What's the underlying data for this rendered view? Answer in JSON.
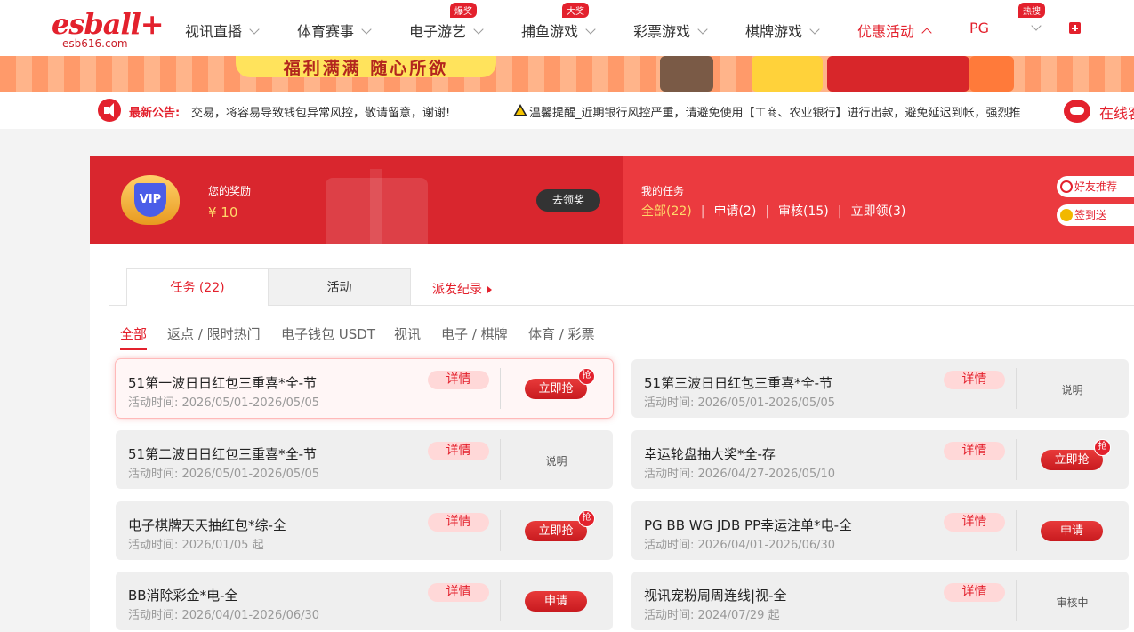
{
  "logo": {
    "word": "esball+",
    "sub": "esb616.com"
  },
  "nav": {
    "items": [
      {
        "label": "视讯直播",
        "badge": ""
      },
      {
        "label": "体育赛事",
        "badge": ""
      },
      {
        "label": "电子游艺",
        "badge": "爆奖"
      },
      {
        "label": "捕鱼游戏",
        "badge": "大奖"
      },
      {
        "label": "彩票游戏",
        "badge": ""
      },
      {
        "label": "棋牌游戏",
        "badge": ""
      },
      {
        "label": "优惠活动",
        "badge": ""
      },
      {
        "label": "PG",
        "badge": ""
      },
      {
        "label": "",
        "badge": "热搜"
      }
    ]
  },
  "banner": {
    "slogan": "福利满满 随心所欲"
  },
  "notice": {
    "label": "最新公告:",
    "text": "交易，将容易导致钱包异常风控，敬请留意，谢谢!",
    "warning": "温馨提醒_近期银行风控严重，请避免使用【工商、农业银行】进行出款，避免延迟到帐，强烈推",
    "service": "在线客服"
  },
  "reward": {
    "label": "您的奖励",
    "amount": "¥ 10",
    "claim_label": "去领奖",
    "vip_text": "VIP"
  },
  "tasks_summary": {
    "label": "我的任务",
    "filters": [
      "全部(22)",
      "申请(2)",
      "审核(15)",
      "立即领(3)"
    ]
  },
  "side": {
    "friend": "好友推荐",
    "checkin": "签到送"
  },
  "tabs": {
    "task": "任务 (22)",
    "activity": "活动",
    "history": "派发纪录"
  },
  "categories": [
    "全部",
    "返点 / 限时热门",
    "电子钱包 USDT",
    "视讯",
    "电子 / 棋牌",
    "体育 / 彩票"
  ],
  "detail_label": "详情",
  "cards": [
    {
      "title": "51第一波日日红包三重喜*全-节",
      "date": "活动时间: 2026/05/01-2026/05/05",
      "action": "立即抢",
      "badge": "抢"
    },
    {
      "title": "51第三波日日红包三重喜*全-节",
      "date": "活动时间: 2026/05/01-2026/05/05",
      "action": "说明",
      "badge": ""
    },
    {
      "title": "51第二波日日红包三重喜*全-节",
      "date": "活动时间: 2026/05/01-2026/05/05",
      "action": "说明",
      "badge": ""
    },
    {
      "title": "幸运轮盘抽大奖*全-存",
      "date": "活动时间: 2026/04/27-2026/05/10",
      "action": "立即抢",
      "badge": "抢"
    },
    {
      "title": "电子棋牌天天抽红包*综-全",
      "date": "活动时间: 2026/01/05 起",
      "action": "立即抢",
      "badge": "抢"
    },
    {
      "title": "PG BB WG JDB PP幸运注单*电-全",
      "date": "活动时间: 2026/04/01-2026/06/30",
      "action": "申请",
      "badge": ""
    },
    {
      "title": "BB消除彩金*电-全",
      "date": "活动时间: 2026/04/01-2026/06/30",
      "action": "申请",
      "badge": ""
    },
    {
      "title": "视讯宠粉周周连线|视-全",
      "date": "活动时间: 2024/07/29 起",
      "action": "审核中",
      "badge": ""
    }
  ],
  "colors": {
    "brand_red": "#e3212d",
    "reward_left": "#d9262e",
    "reward_right": "#eb3a3f",
    "highlight_yellow": "#ffd86a"
  }
}
